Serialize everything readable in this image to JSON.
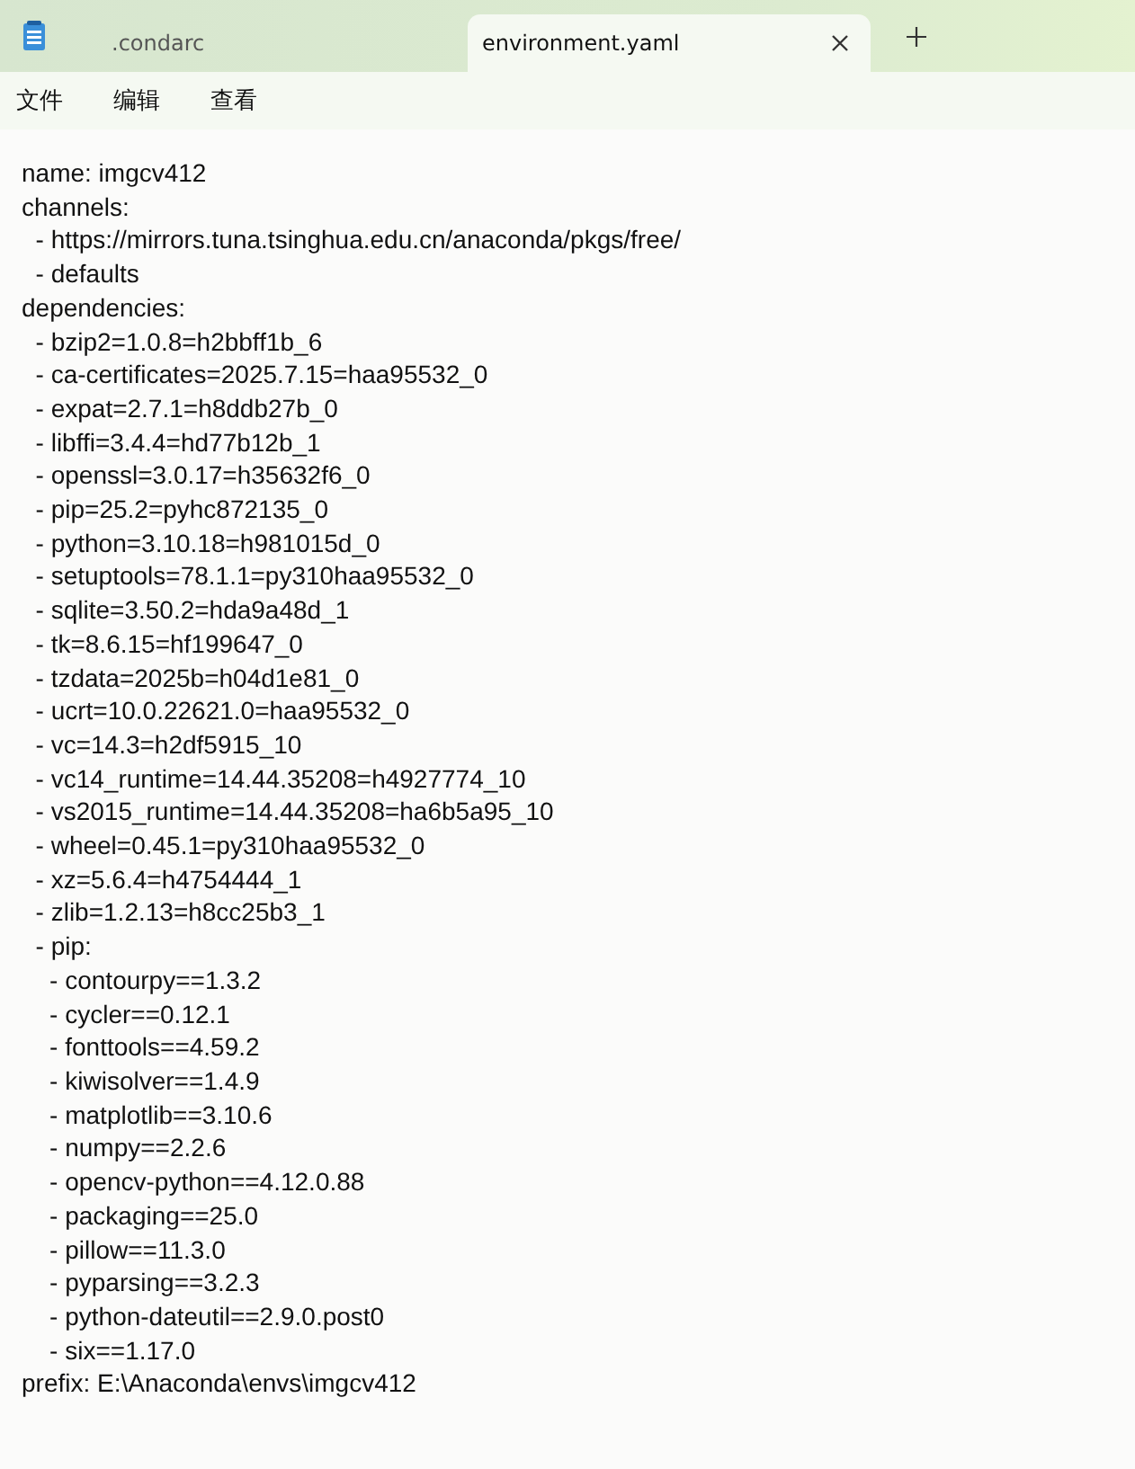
{
  "tabs": [
    {
      "label": ".condarc",
      "selected": false,
      "closable": false
    },
    {
      "label": "environment.yaml",
      "selected": true,
      "closable": true
    }
  ],
  "menu": [
    "文件",
    "编辑",
    "查看"
  ],
  "editor": {
    "lines": [
      "name: imgcv412",
      "channels:",
      "  - https://mirrors.tuna.tsinghua.edu.cn/anaconda/pkgs/free/",
      "  - defaults",
      "dependencies:",
      "  - bzip2=1.0.8=h2bbff1b_6",
      "  - ca-certificates=2025.7.15=haa95532_0",
      "  - expat=2.7.1=h8ddb27b_0",
      "  - libffi=3.4.4=hd77b12b_1",
      "  - openssl=3.0.17=h35632f6_0",
      "  - pip=25.2=pyhc872135_0",
      "  - python=3.10.18=h981015d_0",
      "  - setuptools=78.1.1=py310haa95532_0",
      "  - sqlite=3.50.2=hda9a48d_1",
      "  - tk=8.6.15=hf199647_0",
      "  - tzdata=2025b=h04d1e81_0",
      "  - ucrt=10.0.22621.0=haa95532_0",
      "  - vc=14.3=h2df5915_10",
      "  - vc14_runtime=14.44.35208=h4927774_10",
      "  - vs2015_runtime=14.44.35208=ha6b5a95_10",
      "  - wheel=0.45.1=py310haa95532_0",
      "  - xz=5.6.4=h4754444_1",
      "  - zlib=1.2.13=h8cc25b3_1",
      "  - pip:",
      "    - contourpy==1.3.2",
      "    - cycler==0.12.1",
      "    - fonttools==4.59.2",
      "    - kiwisolver==1.4.9",
      "    - matplotlib==3.10.6",
      "    - numpy==2.2.6",
      "    - opencv-python==4.12.0.88",
      "    - packaging==25.0",
      "    - pillow==11.3.0",
      "    - pyparsing==3.2.3",
      "    - python-dateutil==2.9.0.post0",
      "    - six==1.17.0",
      "prefix: E:\\Anaconda\\envs\\imgcv412"
    ]
  }
}
